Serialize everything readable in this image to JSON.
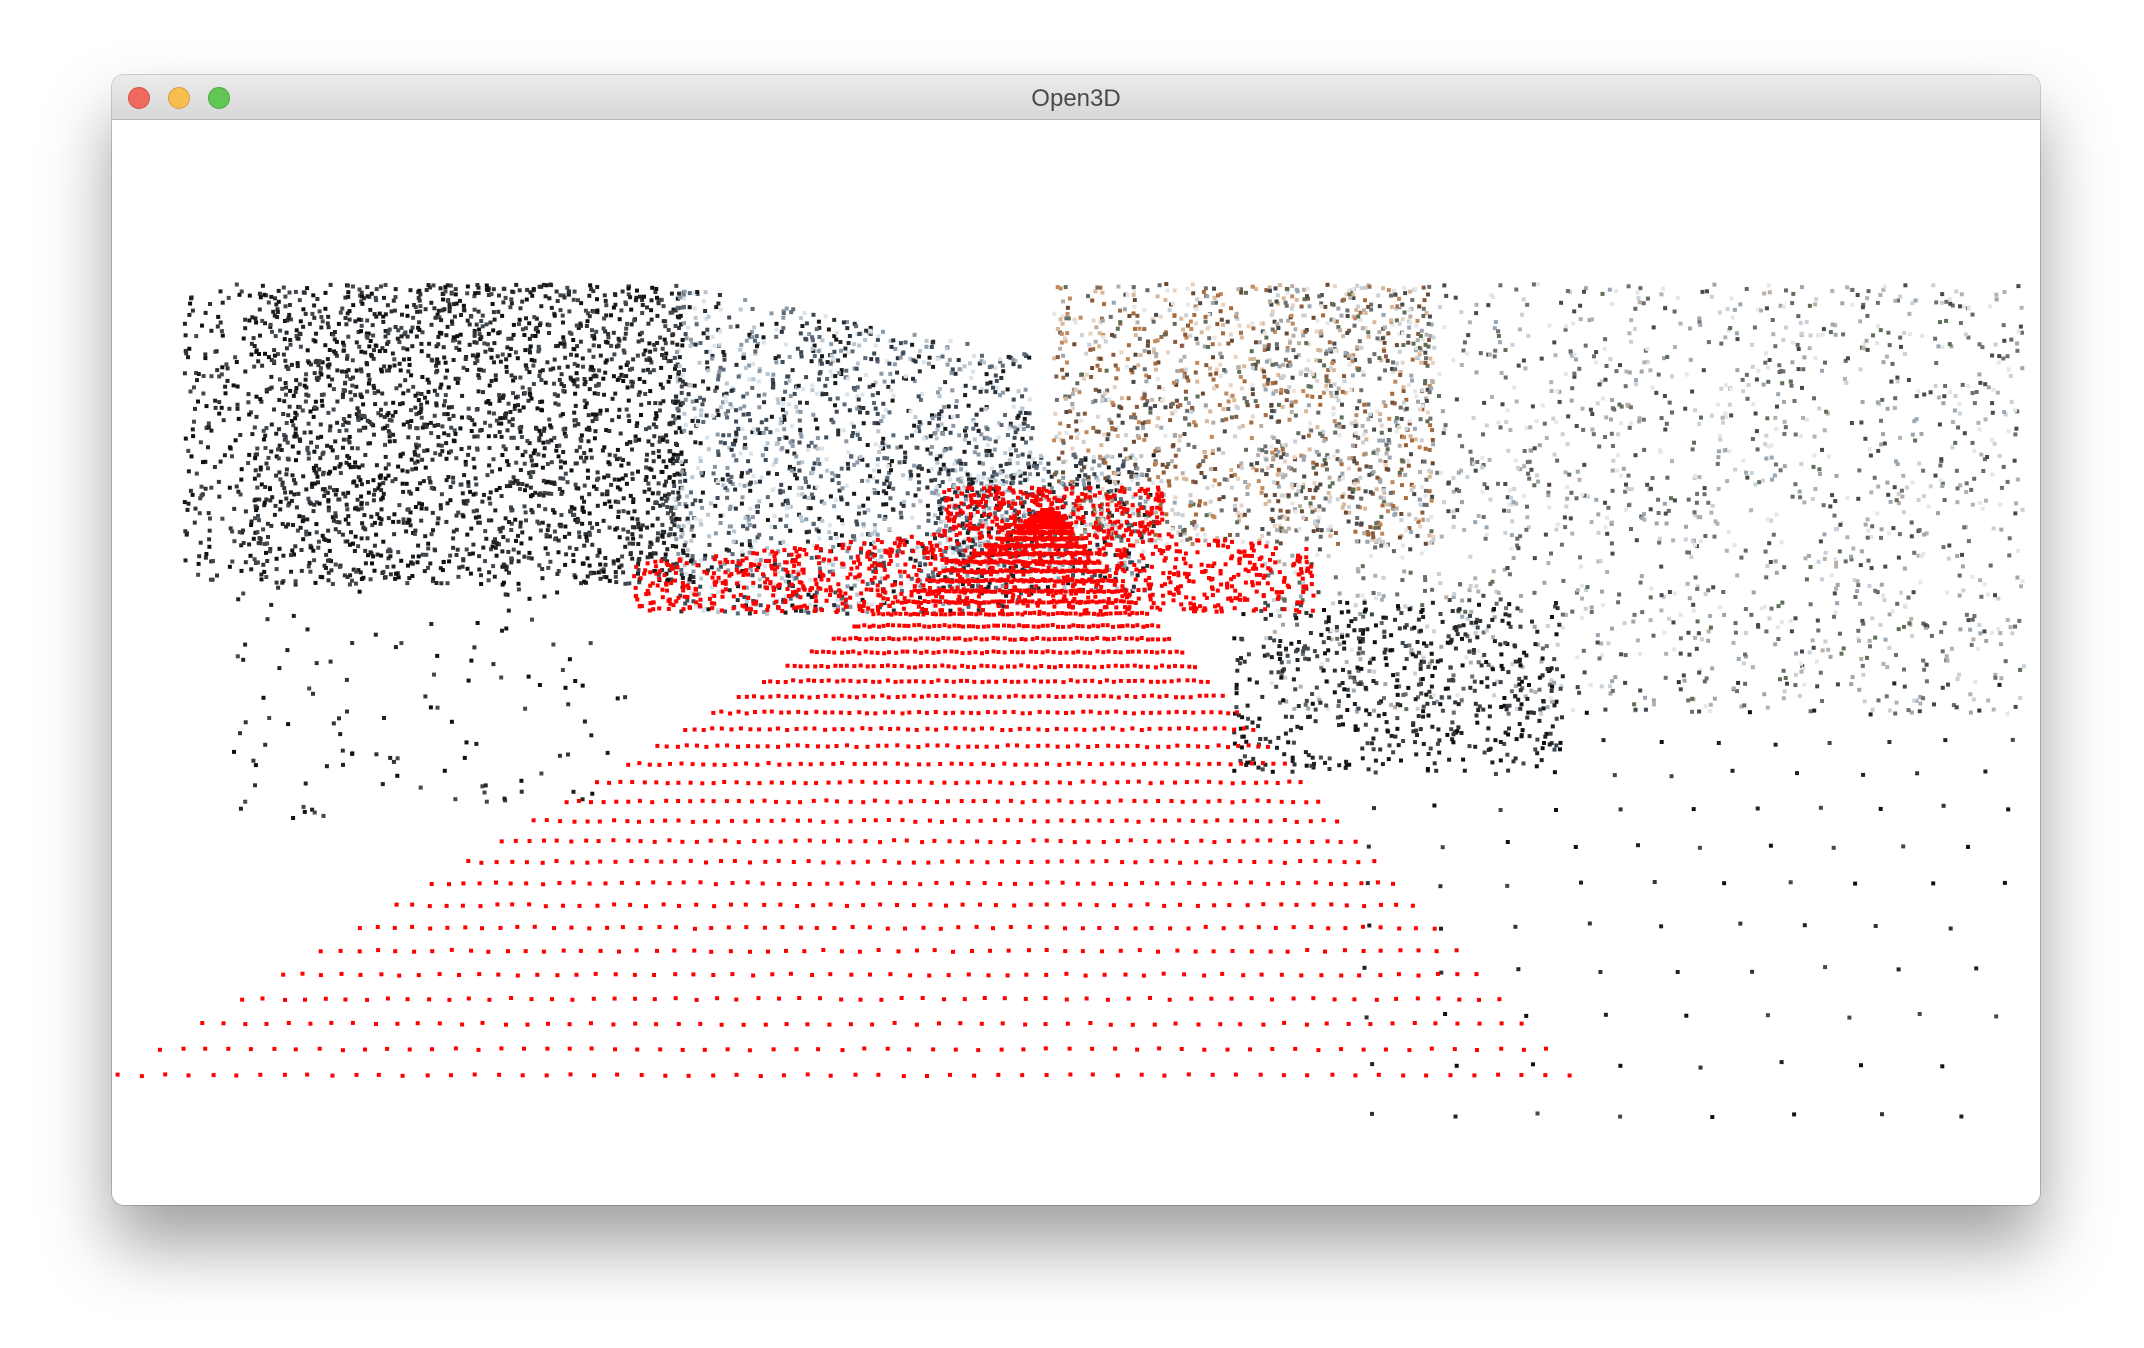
{
  "window": {
    "title": "Open3D"
  },
  "controls": {
    "close": "close-button",
    "minimize": "minimize-button",
    "zoom": "zoom-button"
  },
  "scene": {
    "background_color": "#ffffff",
    "highlight_color": "#ff0000",
    "building_colors": [
      "#1a1a1a",
      "#2b2f36",
      "#3d4a58",
      "#5a6a78",
      "#8a9aa8",
      "#b8c6d2",
      "#d9e3ea"
    ],
    "foliage_colors": [
      "#8a5a3a",
      "#a86b3e",
      "#c28a5c",
      "#6b4a34",
      "#d9b89a",
      "#e8d2c2"
    ],
    "right_colors": [
      "#4a4a4a",
      "#6f6f6f",
      "#9aa7b2",
      "#c8d0d8",
      "#e6e6e6",
      "#5f6f5a",
      "#b8b0a8"
    ],
    "dark_colors": [
      "#111111",
      "#222222",
      "#333333",
      "#404850"
    ]
  }
}
